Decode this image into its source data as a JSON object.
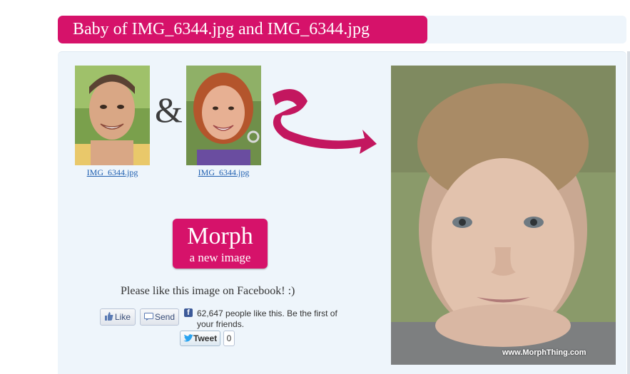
{
  "title": "Baby of IMG_6344.jpg and IMG_6344.jpg",
  "parents": [
    {
      "link_text": "IMG_6344.jpg"
    },
    {
      "link_text": "IMG_6344.jpg"
    }
  ],
  "ampersand": "&",
  "morph_button": {
    "line1": "Morph",
    "line2": "a new image"
  },
  "facebook": {
    "prompt": "Please like this image on Facebook! :)",
    "like_label": "Like",
    "send_label": "Send",
    "count_text_line1": "62,647 people like this. Be the first of",
    "count_text_line2": "your friends."
  },
  "twitter": {
    "tweet_label": "Tweet",
    "count": "0"
  },
  "watermark": "www.MorphThing.com",
  "colors": {
    "accent": "#d6126a",
    "panel": "#eef5fb",
    "link": "#1f5fb0"
  }
}
